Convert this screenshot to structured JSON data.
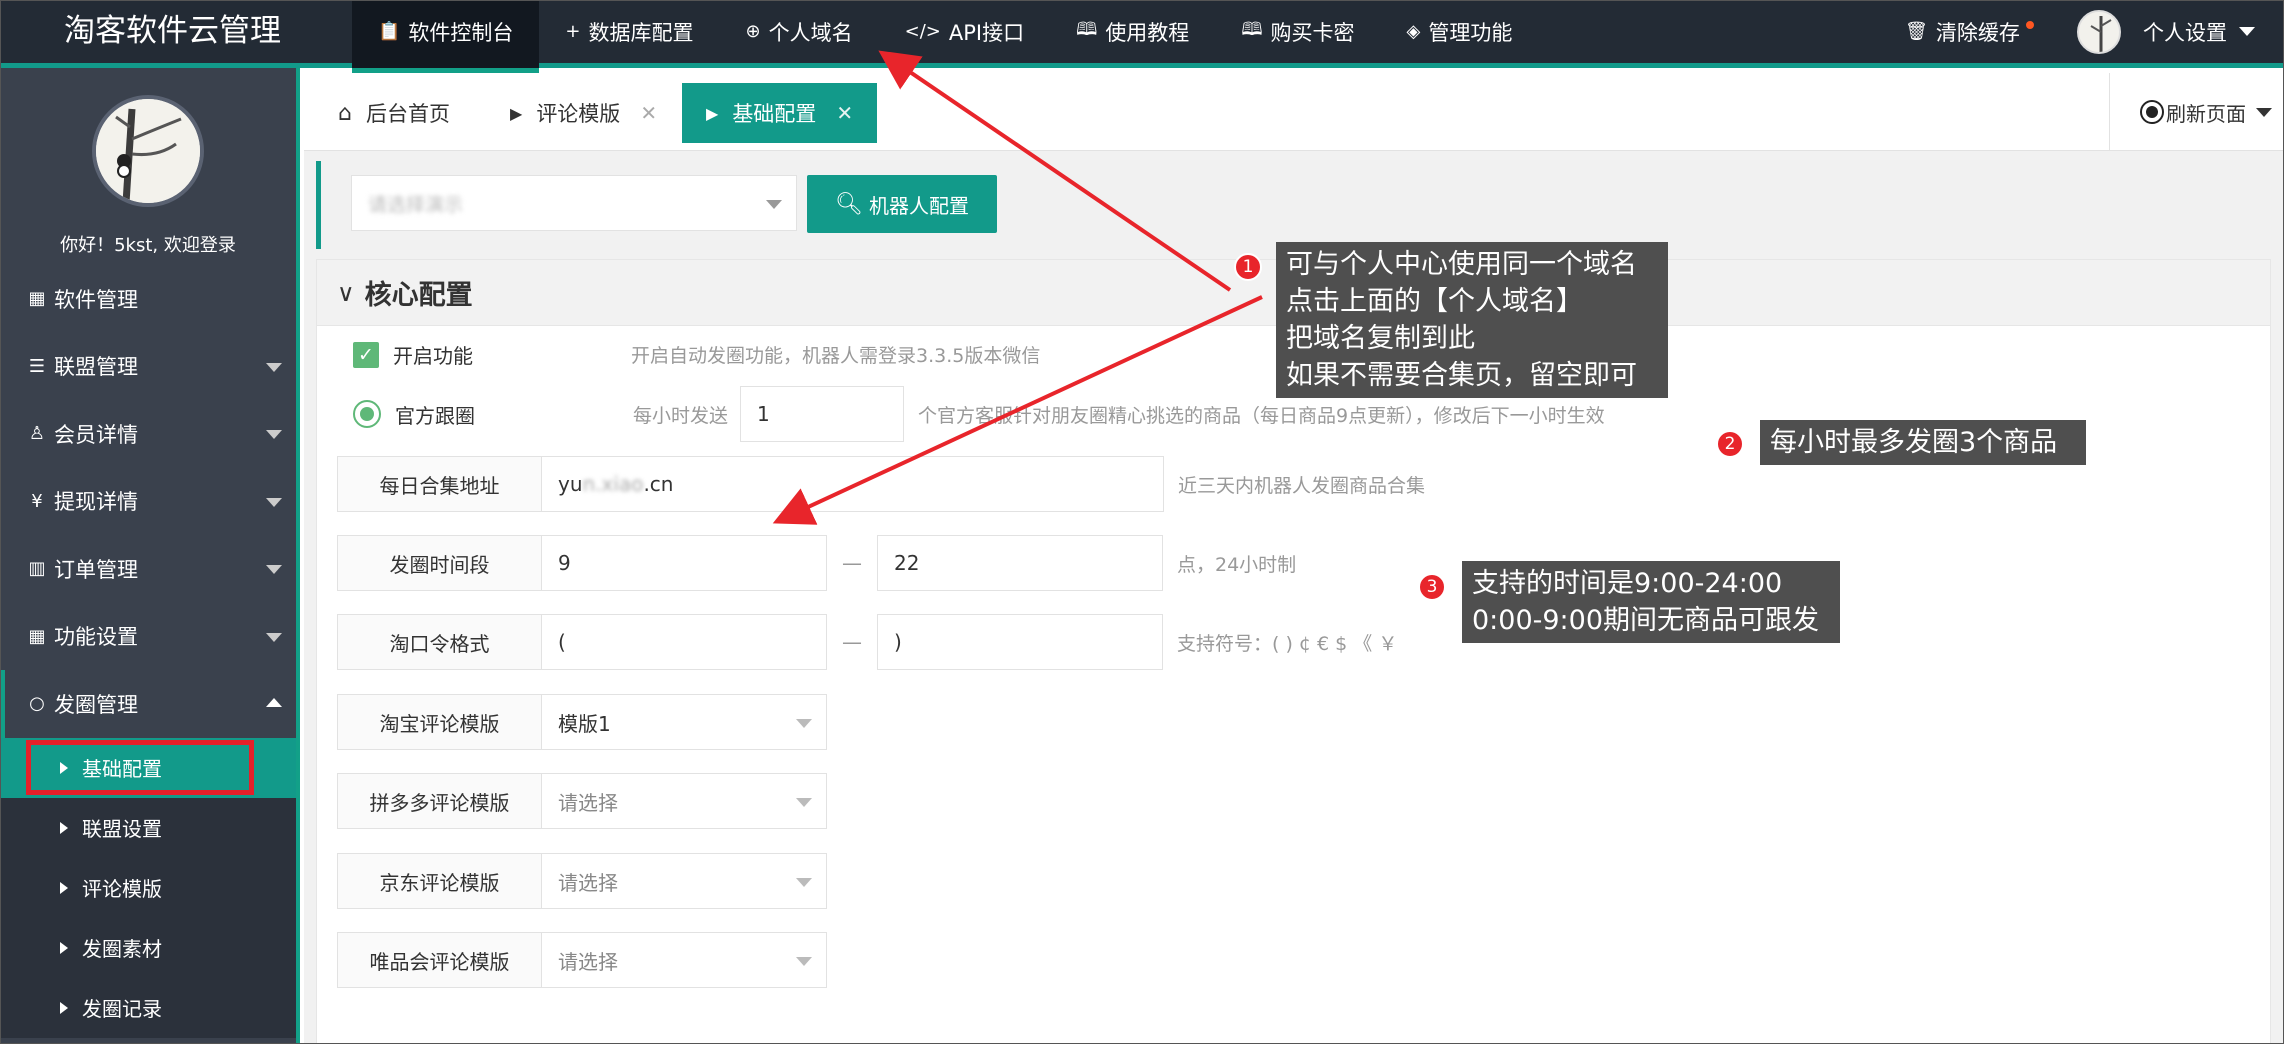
{
  "app": {
    "title": "淘客软件云管理"
  },
  "nav": [
    {
      "label": "软件控制台",
      "icon": "clipboard-icon",
      "glyph": "📋",
      "active": true
    },
    {
      "label": "数据库配置",
      "icon": "plus-icon",
      "glyph": "+",
      "active": false
    },
    {
      "label": "个人域名",
      "icon": "globe-icon",
      "glyph": "🌐",
      "active": false
    },
    {
      "label": "API接口",
      "icon": "code-icon",
      "glyph": "</>",
      "active": false
    },
    {
      "label": "使用教程",
      "icon": "book-icon",
      "glyph": "📖",
      "active": false
    },
    {
      "label": "购买卡密",
      "icon": "cart-icon",
      "glyph": "📖",
      "active": false
    },
    {
      "label": "管理功能",
      "icon": "layers-icon",
      "glyph": "◈",
      "active": false
    }
  ],
  "header_right": {
    "clear_cache": "清除缓存",
    "personal_settings": "个人设置"
  },
  "sidebar": {
    "greeting": "你好！5kst, 欢迎登录",
    "items": [
      {
        "label": "软件管理",
        "icon": "grid-icon",
        "glyph": "▦",
        "expandable": false
      },
      {
        "label": "联盟管理",
        "icon": "list-icon",
        "glyph": "☰",
        "expandable": true
      },
      {
        "label": "会员详情",
        "icon": "user-icon",
        "glyph": "👤",
        "expandable": true
      },
      {
        "label": "提现详情",
        "icon": "yen-icon",
        "glyph": "¥",
        "expandable": true
      },
      {
        "label": "订单管理",
        "icon": "table-icon",
        "glyph": "▥",
        "expandable": true
      },
      {
        "label": "功能设置",
        "icon": "grid-icon",
        "glyph": "▦",
        "expandable": true
      },
      {
        "label": "发圈管理",
        "icon": "circle-icon",
        "glyph": "○",
        "expandable": true,
        "open": true
      }
    ],
    "subitems": [
      {
        "label": "基础配置",
        "active": true
      },
      {
        "label": "联盟设置",
        "active": false
      },
      {
        "label": "评论模版",
        "active": false
      },
      {
        "label": "发圈素材",
        "active": false
      },
      {
        "label": "发圈记录",
        "active": false
      }
    ]
  },
  "tabs": [
    {
      "label": "后台首页",
      "icon": "home-icon"
    },
    {
      "label": "评论模版",
      "closable": true
    },
    {
      "label": "基础配置",
      "closable": true,
      "active": true
    }
  ],
  "refresh_label": "刷新页面",
  "toolbar": {
    "robot_select_value": "请选择演示",
    "robot_button": "机器人配置"
  },
  "panel": {
    "title": "核心配置",
    "enable": {
      "label": "开启功能",
      "hint": "开启自动发圈功能，机器人需登录3.3.5版本微信"
    },
    "official": {
      "label": "官方跟圈",
      "prefix": "每小时发送",
      "value": "1",
      "hint": "个官方客服针对朋友圈精心挑选的商品（每日商品9点更新），修改后下一小时生效"
    },
    "daily_url": {
      "label": "每日合集地址",
      "value_a": "yu",
      "value_blur": "n.xiao",
      "value_b": ".cn",
      "hint": "近三天内机器人发圈商品合集"
    },
    "time_range": {
      "label": "发圈时间段",
      "start": "9",
      "end": "22",
      "sep": "—",
      "hint": "点，24小时制"
    },
    "password_format": {
      "label": "淘口令格式",
      "left": "(",
      "right": ")",
      "sep": "—",
      "hint": "支持符号：( ) ¢ € $ 《 ￥"
    },
    "taobao_tpl": {
      "label": "淘宝评论模版",
      "value": "模版1"
    },
    "pdd_tpl": {
      "label": "拼多多评论模版",
      "value": "请选择"
    },
    "jd_tpl": {
      "label": "京东评论模版",
      "value": "请选择"
    },
    "vip_tpl": {
      "label": "唯品会评论模版",
      "value": "请选择"
    }
  },
  "annotations": [
    {
      "num": "1",
      "lines": [
        "可与个人中心使用同一个域名",
        "点击上面的【个人域名】",
        "把域名复制到此",
        "如果不需要合集页，留空即可"
      ]
    },
    {
      "num": "2",
      "lines": [
        "每小时最多发圈3个商品"
      ]
    },
    {
      "num": "3",
      "lines": [
        "支持的时间是9:00-24:00",
        "0:00-9:00期间无商品可跟发"
      ]
    }
  ],
  "colors": {
    "topbar": "#232b35",
    "sidebar": "#3a414d",
    "accent": "#129a8a",
    "annotation_red": "#e8252b",
    "callout_bg": "#4f4f4f"
  }
}
